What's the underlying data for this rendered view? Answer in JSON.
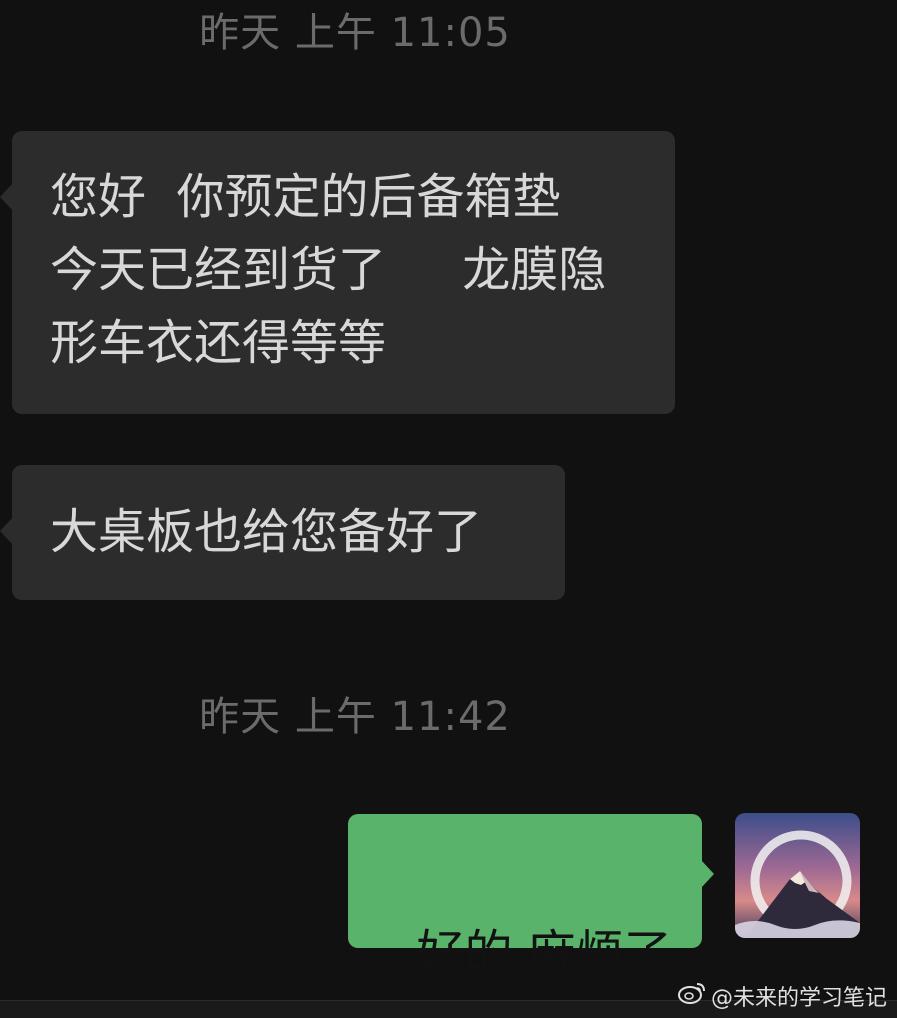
{
  "chat": {
    "messages": [
      {
        "timestamp": "昨天 上午 11:05",
        "side": "received",
        "lines": [
          "您好  你预定的后备箱垫",
          "今天已经到货了     龙膜隐",
          "形车衣还得等等"
        ]
      },
      {
        "side": "received",
        "text": "大桌板也给您备好了"
      },
      {
        "timestamp": "昨天 上午 11:42",
        "side": "sent",
        "text": "好的 麻烦了"
      }
    ],
    "avatar": {
      "icon": "mountain-avatar-icon"
    }
  },
  "watermark": {
    "text": "@未来的学习笔记",
    "icon": "weibo-icon"
  },
  "colors": {
    "background": "#111111",
    "received_bubble": "#2c2c2c",
    "sent_bubble": "#59b36a",
    "timestamp": "#6b6b6b"
  }
}
